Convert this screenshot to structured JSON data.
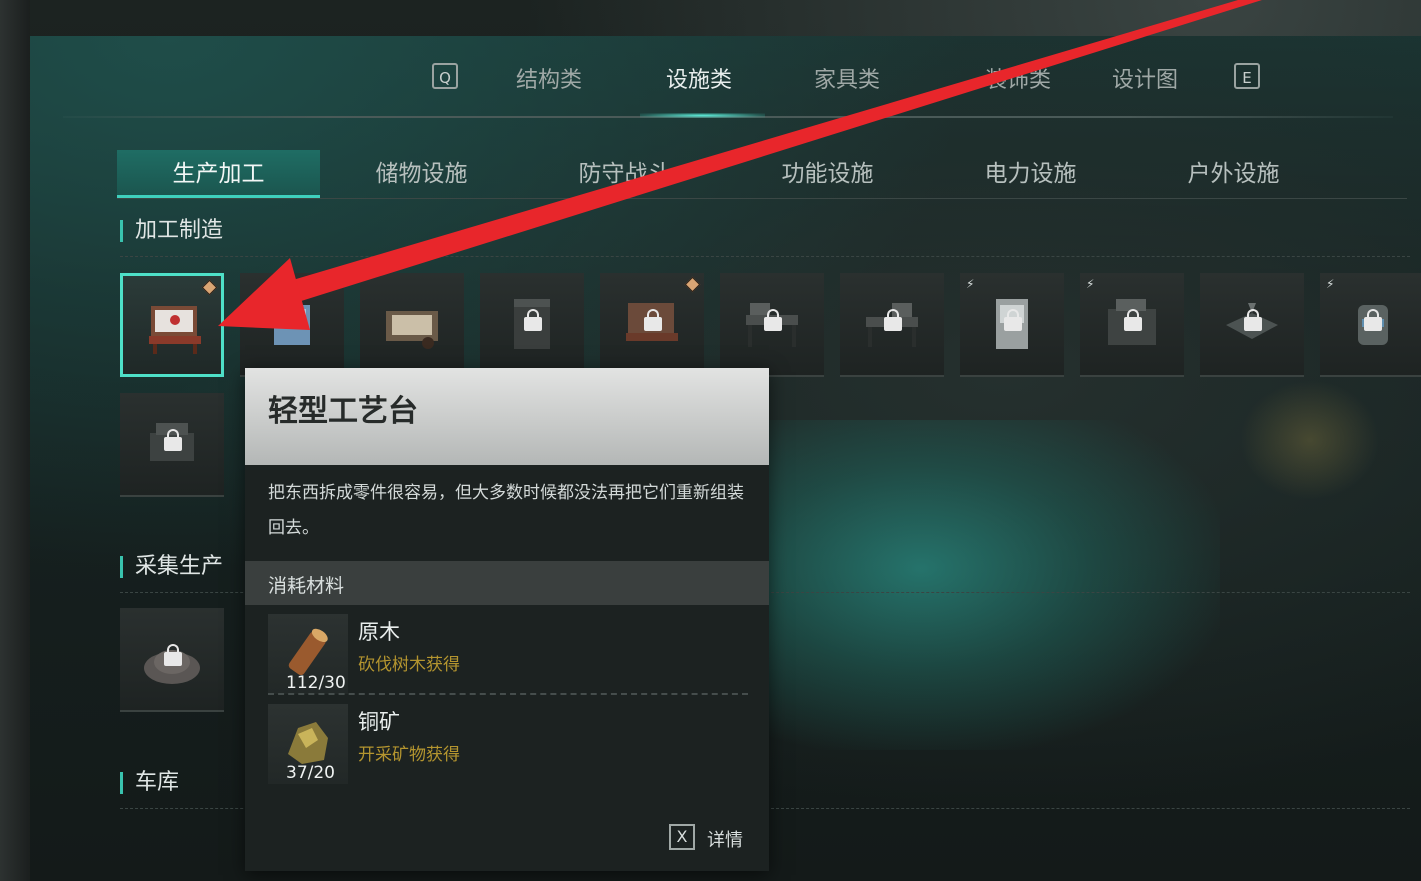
{
  "top_tabs": {
    "left_key": "Q",
    "right_key": "E",
    "items": [
      {
        "label": "结构类",
        "active": false
      },
      {
        "label": "设施类",
        "active": true
      },
      {
        "label": "家具类",
        "active": false
      },
      {
        "label": "…装饰类",
        "active": false
      },
      {
        "label": "设计图",
        "active": false
      }
    ]
  },
  "sub_tabs": [
    {
      "label": "生产加工",
      "active": true
    },
    {
      "label": "储物设施",
      "active": false
    },
    {
      "label": "防守战斗",
      "active": false
    },
    {
      "label": "功能设施",
      "active": false
    },
    {
      "label": "电力设施",
      "active": false
    },
    {
      "label": "户外设施",
      "active": false
    }
  ],
  "sections": [
    {
      "title": "加工制造"
    },
    {
      "title": "采集生产"
    },
    {
      "title": "车库"
    }
  ],
  "popup": {
    "title": "轻型工艺台",
    "description": "把东西拆成零件很容易，但大多数时候都没法再把它们重新组装回去。",
    "consume_label": "消耗材料",
    "materials": [
      {
        "name": "原木",
        "source": "砍伐树木获得",
        "count": "112/30",
        "icon": "log-icon"
      },
      {
        "name": "铜矿",
        "source": "开采矿物获得",
        "count": "37/20",
        "icon": "copper-ore-icon"
      }
    ],
    "detail_key": "X",
    "detail_label": "详情"
  },
  "colors": {
    "accent": "#3fd0bd",
    "arrow": "#e8262b",
    "source_text": "#b4952f"
  }
}
